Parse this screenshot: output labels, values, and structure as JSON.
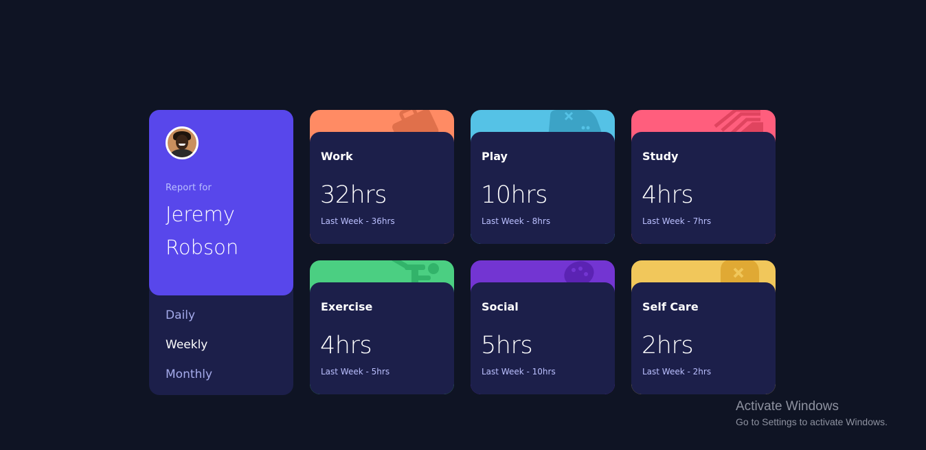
{
  "profile": {
    "report_for": "Report for",
    "name": "Jeremy Robson",
    "periods": [
      "Daily",
      "Weekly",
      "Monthly"
    ],
    "active_period": "Weekly"
  },
  "cards": [
    {
      "title": "Work",
      "current": "32hrs",
      "previous": "Last Week - 36hrs",
      "color": "#ff8b64",
      "icon": "briefcase-icon"
    },
    {
      "title": "Play",
      "current": "10hrs",
      "previous": "Last Week - 8hrs",
      "color": "#55c2e6",
      "icon": "gamepad-icon"
    },
    {
      "title": "Study",
      "current": "4hrs",
      "previous": "Last Week - 7hrs",
      "color": "#ff5e7d",
      "icon": "book-icon"
    },
    {
      "title": "Exercise",
      "current": "4hrs",
      "previous": "Last Week - 5hrs",
      "color": "#4bcf82",
      "icon": "running-icon"
    },
    {
      "title": "Social",
      "current": "5hrs",
      "previous": "Last Week - 10hrs",
      "color": "#7335d2",
      "icon": "social-icon"
    },
    {
      "title": "Self Care",
      "current": "2hrs",
      "previous": "Last Week - 2hrs",
      "color": "#f1c75b",
      "icon": "self-care-icon"
    }
  ],
  "windows_watermark": {
    "title": "Activate Windows",
    "subtitle": "Go to Settings to activate Windows."
  }
}
